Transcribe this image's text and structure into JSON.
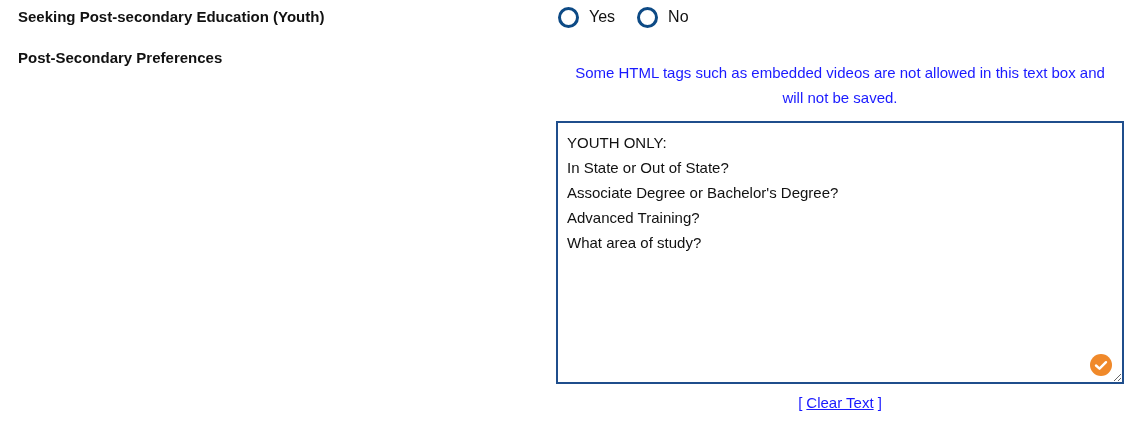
{
  "seeking_education": {
    "label": "Seeking Post-secondary Education (Youth)",
    "options": [
      {
        "label": "Yes",
        "selected": false
      },
      {
        "label": "No",
        "selected": false
      }
    ]
  },
  "preferences": {
    "label": "Post-Secondary Preferences",
    "notice": "Some HTML tags such as embedded videos are not allowed in this text box and will not be saved.",
    "text": "YOUTH ONLY:\nIn State or Out of State?\nAssociate Degree or Bachelor's Degree?\nAdvanced Training?\nWhat area of study?",
    "valid": true,
    "clear_link": {
      "open": "[",
      "label": "Clear Text",
      "close": "]"
    }
  }
}
